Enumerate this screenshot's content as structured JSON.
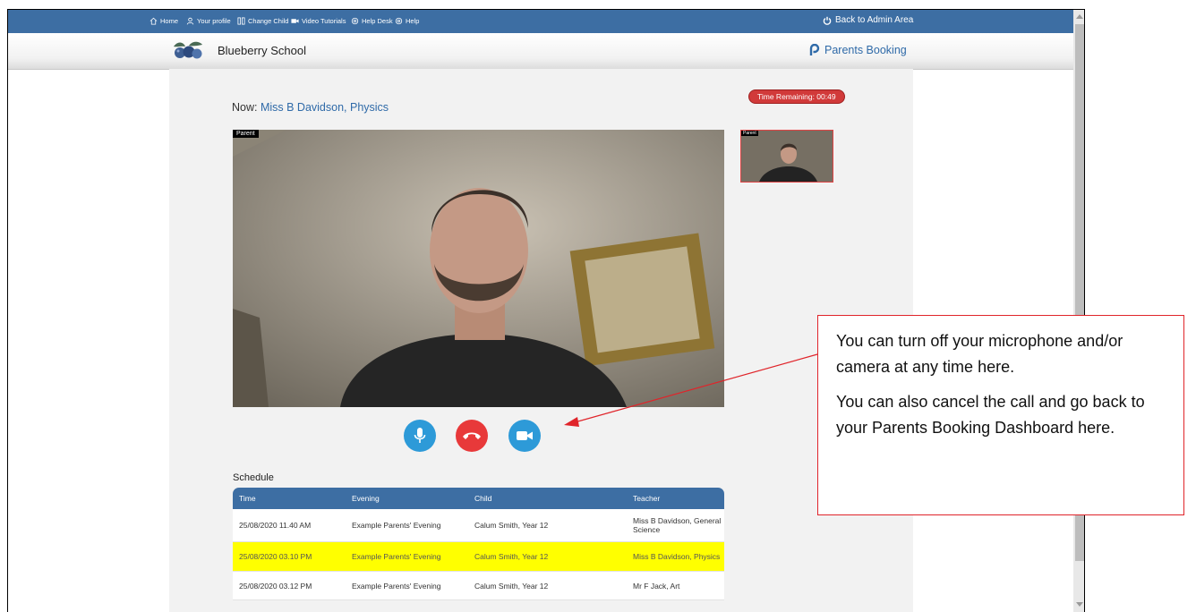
{
  "nav": {
    "items": [
      {
        "label": "Home",
        "icon": "home-icon"
      },
      {
        "label": "Your profile",
        "icon": "user-icon"
      },
      {
        "label": "Change Child",
        "icon": "swap-icon"
      },
      {
        "label": "Video Tutorials",
        "icon": "video-icon"
      },
      {
        "label": "Help Desk",
        "icon": "support-icon"
      },
      {
        "label": "Help",
        "icon": "help-icon"
      }
    ],
    "back_label": "Back to Admin Area"
  },
  "header": {
    "school_name": "Blueberry School",
    "brand": "Parents Booking"
  },
  "call": {
    "now_prefix": "Now: ",
    "now_teacher": "Miss B Davidson, Physics",
    "time_remaining": "Time Remaining: 00:49",
    "main_video_label": "Parent",
    "thumb_video_label": "Parent"
  },
  "schedule": {
    "title": "Schedule",
    "columns": [
      "Time",
      "Evening",
      "Child",
      "Teacher"
    ],
    "rows": [
      {
        "time": "25/08/2020 11.40 AM",
        "evening": "Example Parents' Evening",
        "child": "Calum Smith, Year 12",
        "teacher": "Miss B Davidson, General Science"
      },
      {
        "time": "25/08/2020 03.10 PM",
        "evening": "Example Parents' Evening",
        "child": "Calum Smith, Year 12",
        "teacher": "Miss B Davidson, Physics"
      },
      {
        "time": "25/08/2020 03.12 PM",
        "evening": "Example Parents' Evening",
        "child": "Calum Smith, Year 12",
        "teacher": "Mr F Jack, Art"
      }
    ]
  },
  "callout": {
    "line1": "You can turn off your microphone and/or camera at any time here.",
    "line2": "You can also cancel the call and go back to your Parents Booking Dashboard here."
  },
  "colors": {
    "nav_bg": "#3d6ea3",
    "brand": "#2f6aa8",
    "hangup": "#e8393a",
    "control": "#2d9ad8",
    "highlight_row": "#ffff00",
    "callout_border": "#e0242a"
  }
}
